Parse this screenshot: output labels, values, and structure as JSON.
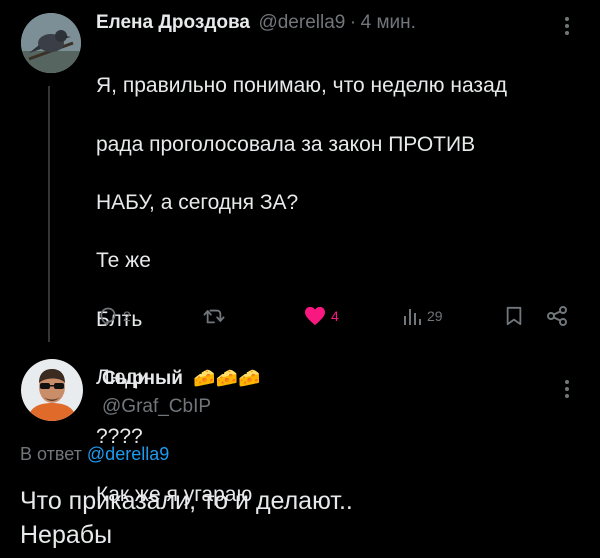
{
  "tweet": {
    "author_name": "Елена Дроздова",
    "handle": "@derella9",
    "separator": "·",
    "time": "4 мин.",
    "lines": [
      "Я, правильно понимаю, что неделю назад",
      "рада проголосовала за закон ПРОТИВ",
      "НАБУ, а сегодня ЗА?",
      "Те же",
      "Блть",
      "Люди",
      "????",
      "Как же я угараю"
    ],
    "actions": {
      "reply_count": "2",
      "retweet_count": "",
      "like_count": "4",
      "view_count": "29"
    }
  },
  "reply": {
    "author_name": "Сырный",
    "name_emoji": "🧀🧀🧀",
    "handle": "@Graf_CbIP",
    "reply_to_prefix": "В ответ",
    "reply_to_handle": "@derella9",
    "lines": [
      "Что приказали, то и делают..",
      "Нерабы"
    ]
  },
  "colors": {
    "background": "#000000",
    "text": "#e7e9ea",
    "muted": "#71767b",
    "link": "#1d9bf0",
    "like": "#f91880"
  },
  "icons": [
    "more-icon",
    "reply-icon",
    "retweet-icon",
    "heart-icon",
    "views-icon",
    "bookmark-icon",
    "share-icon"
  ]
}
